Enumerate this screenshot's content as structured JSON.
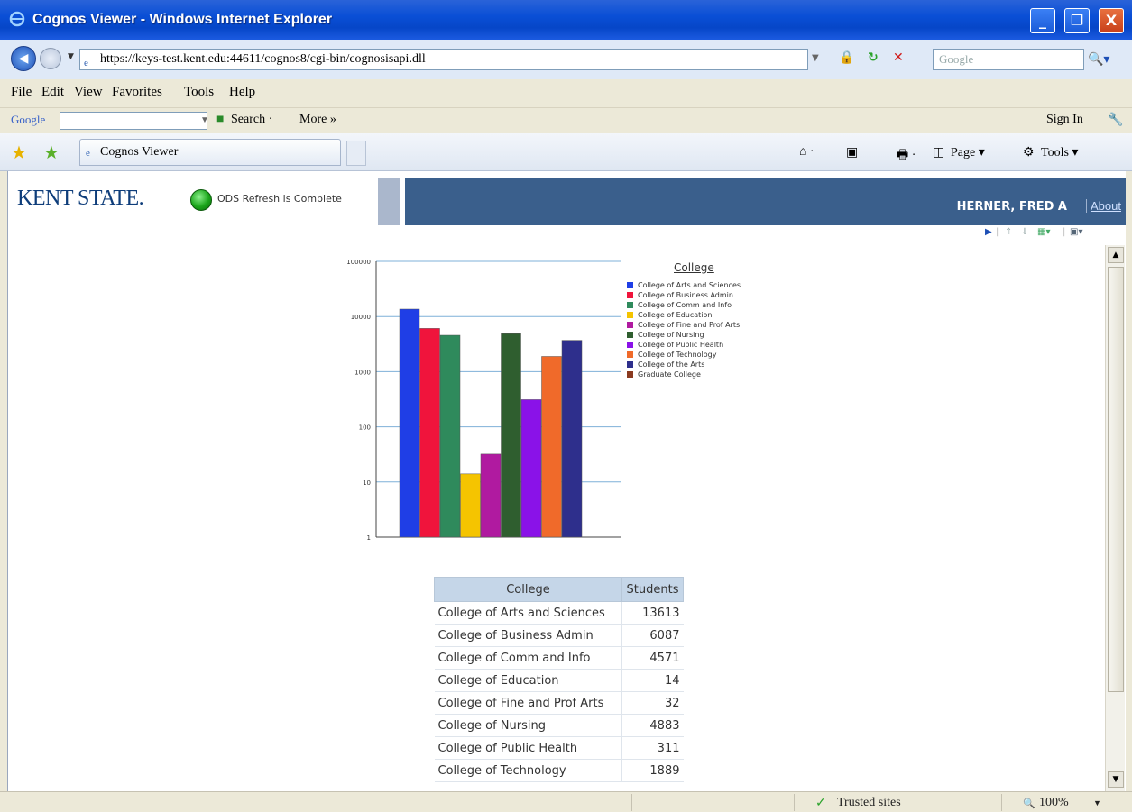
{
  "window": {
    "title": "Cognos Viewer - Windows Internet Explorer",
    "min_glyph": "_",
    "max_glyph": "❐",
    "close_glyph": "X"
  },
  "addressbar": {
    "url": "https://keys-test.kent.edu:44611/cognos8/cgi-bin/cognosisapi.dll",
    "search_placeholder": "Google"
  },
  "menu": [
    "File",
    "Edit",
    "View",
    "Favorites",
    "Tools",
    "Help"
  ],
  "google_toolbar": {
    "logo": "Google",
    "search_label": "Search ·",
    "more_label": "More »",
    "signin_label": "Sign In"
  },
  "tab": {
    "title": "Cognos Viewer"
  },
  "commandbar": {
    "page_label": "Page ▾",
    "tools_label": "Tools ▾"
  },
  "header": {
    "logo_text": "KENT STATE.",
    "status_text": "ODS Refresh is Complete",
    "user_name": "HERNER, FRED A",
    "about_label": "About"
  },
  "chart_data": {
    "type": "bar",
    "scale": "log",
    "ylim": [
      1,
      100000
    ],
    "yticks": [
      "100000",
      "10000",
      "1000",
      "100",
      "10",
      "1"
    ],
    "legend_title": "College",
    "legend_position": "right",
    "categories": [
      "College of Arts and Sciences",
      "College of Business Admin",
      "College of Comm and Info",
      "College of Education",
      "College of Fine and Prof Arts",
      "College of Nursing",
      "College of Public Health",
      "College of Technology",
      "College of the Arts",
      "Graduate College"
    ],
    "values": [
      13613,
      6087,
      4571,
      14,
      32,
      4883,
      311,
      1889,
      3700,
      null
    ],
    "colors": [
      "#1f3ee6",
      "#f0143c",
      "#2f8a5c",
      "#f5c400",
      "#b01aa0",
      "#2f5e2f",
      "#8a12e8",
      "#f06a2a",
      "#2e2f8c",
      "#8a3a20"
    ]
  },
  "table": {
    "headers": [
      "College",
      "Students"
    ],
    "rows": [
      [
        "College of Arts and Sciences",
        "13613"
      ],
      [
        "College of Business Admin",
        "6087"
      ],
      [
        "College of Comm and Info",
        "4571"
      ],
      [
        "College of Education",
        "14"
      ],
      [
        "College of Fine and Prof Arts",
        "32"
      ],
      [
        "College of Nursing",
        "4883"
      ],
      [
        "College of Public Health",
        "311"
      ],
      [
        "College of Technology",
        "1889"
      ]
    ]
  },
  "statusbar": {
    "zone": "Trusted sites",
    "zoom": "100%"
  }
}
